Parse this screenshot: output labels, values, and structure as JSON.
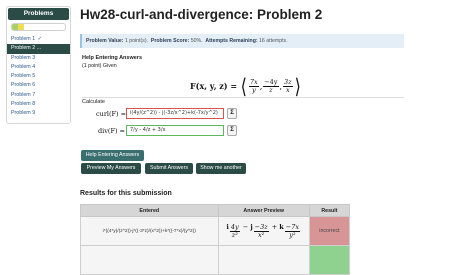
{
  "sidebar": {
    "header": "Problems",
    "progress": {
      "correct_fraction": 0.111,
      "partial_fraction": 0.111
    },
    "items": [
      {
        "label": "Problem 1",
        "status": "✓"
      },
      {
        "label": "Problem 2",
        "status": "..."
      },
      {
        "label": "Problem 3",
        "status": ""
      },
      {
        "label": "Problem 4",
        "status": ""
      },
      {
        "label": "Problem 5",
        "status": ""
      },
      {
        "label": "Problem 6",
        "status": ""
      },
      {
        "label": "Problem 7",
        "status": ""
      },
      {
        "label": "Problem 8",
        "status": ""
      },
      {
        "label": "Problem 9",
        "status": ""
      }
    ],
    "active_index": 1
  },
  "page": {
    "title": "Hw28-curl-and-divergence: Problem 2"
  },
  "info": {
    "value_label": "Problem Value:",
    "value": "1 point(s).",
    "score_label": "Problem Score:",
    "score": "50%.",
    "attempts_label": "Attempts Remaining:",
    "attempts": "16 attempts."
  },
  "problem": {
    "help_link": "Help Entering Answers",
    "given": "(1 point) Given",
    "formula_lhs": "F(x, y, z) =",
    "calculate": "Calculate",
    "curl_label": "curl(F) =",
    "curl_value": "i(4y/(z^2)) - j(-3z/x^2)+k(-7x/y^2)",
    "div_label": "div(F) =",
    "div_value": "7/y - 4/z + 3/x",
    "sigma": "Σ"
  },
  "buttons": {
    "help": "Help Entering Answers",
    "preview": "Preview My Answers",
    "submit": "Submit Answers",
    "show": "Show me another"
  },
  "results": {
    "title": "Results for this submission",
    "headers": [
      "Entered",
      "Answer Preview",
      "Result"
    ],
    "row1": {
      "entered": "i*((4*y)/(z^2))-j*((-3*z)/(x^2))+k*((-7*x)/(y^2))",
      "result": "incorrect"
    }
  },
  "colors": {
    "accent": "#2b4b47",
    "info_bg": "#e3eef7",
    "incorrect": "#d89595",
    "correct": "#8fd28f"
  }
}
